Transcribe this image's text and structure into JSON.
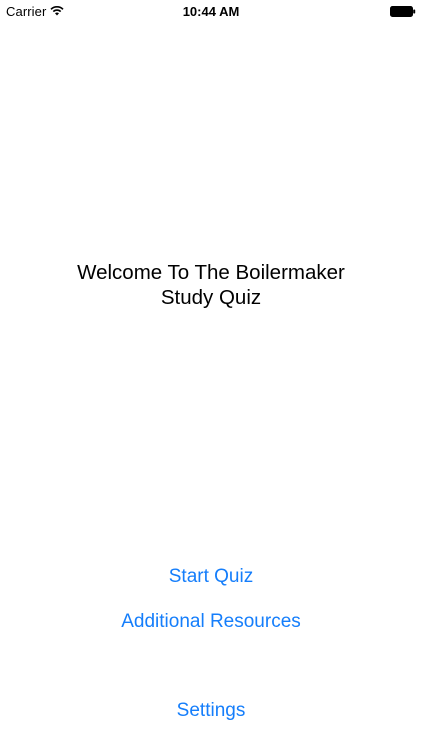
{
  "status_bar": {
    "carrier": "Carrier",
    "time": "10:44 AM",
    "wifi_icon": "wifi-icon",
    "battery_icon": "battery-full-icon"
  },
  "main": {
    "welcome_line1": "Welcome To The Boilermaker",
    "welcome_line2": "Study Quiz"
  },
  "actions": {
    "start_quiz": "Start Quiz",
    "additional_resources": "Additional Resources",
    "settings": "Settings"
  },
  "colors": {
    "link": "#157efb",
    "text": "#000000",
    "background": "#ffffff"
  }
}
